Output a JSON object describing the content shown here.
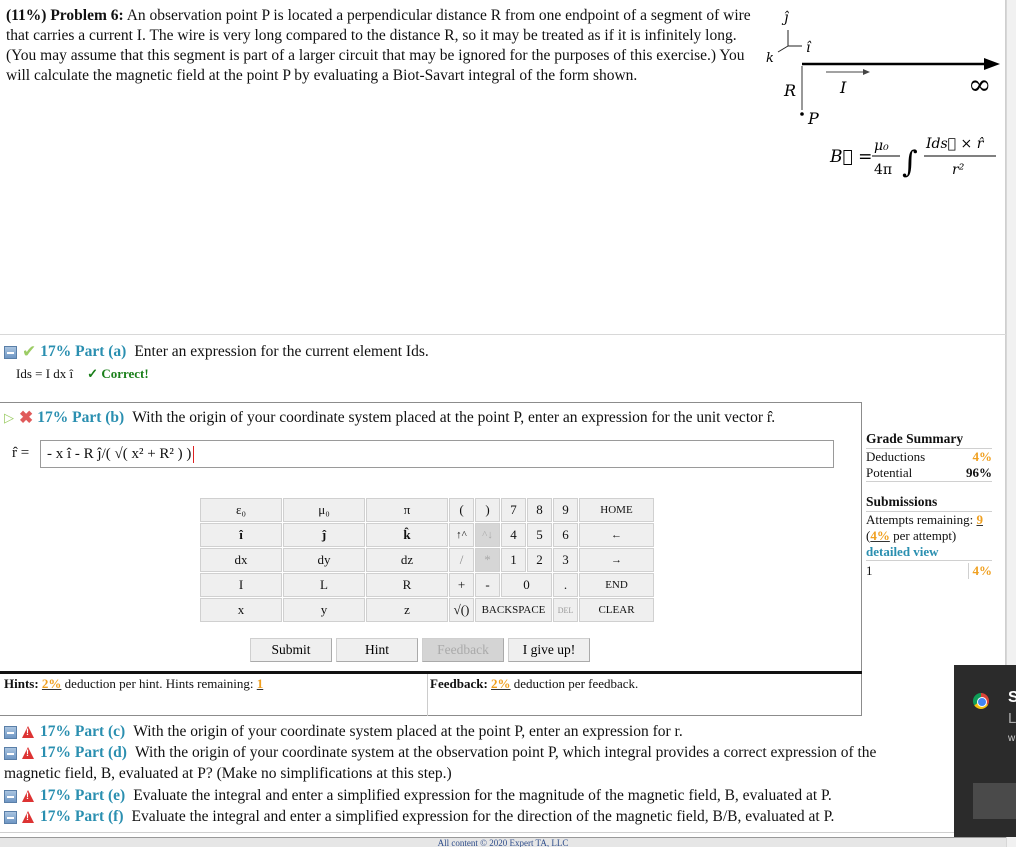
{
  "problem": {
    "weight": "(11%)",
    "title": "Problem 6:",
    "text": "An observation point P is located a perpendicular distance R from one endpoint of a segment of wire that carries a current I. The wire is very long compared to the distance R, so it may be treated as if it is infinitely long. (You may assume that this segment is part of a larger circuit that may be ignored for the purposes of this exercise.) You will calculate the magnetic field at the point P by evaluating a Biot-Savart integral of the form shown."
  },
  "figure": {
    "axis_j": "ĵ",
    "axis_i": "î",
    "axis_k": "k",
    "label_R": "R",
    "label_I": "I",
    "label_P": "P",
    "infinity": "∞",
    "formula_lhs": "B⃗ =",
    "formula_coef_num": "μ₀",
    "formula_coef_den": "4π",
    "formula_integral": "∫",
    "formula_num": "Ids⃗ × r̂",
    "formula_den": "r²"
  },
  "parts": {
    "a": {
      "weight": "17%",
      "label": "Part (a)",
      "text": "Enter an expression for the current element Ids.",
      "answer_lhs": "Ids = I dx î",
      "status": "✓ Correct!"
    },
    "b": {
      "weight": "17%",
      "label": "Part (b)",
      "text": "With the origin of your coordinate system placed at the point P, enter an expression for the unit vector r̂.",
      "input_label": "r̂ =",
      "input_value": "- x î - R ĵ/( √( x² + R² ) )"
    },
    "c": {
      "weight": "17%",
      "label": "Part (c)",
      "text": "With the origin of your coordinate system placed at the point P, enter an expression for r."
    },
    "d": {
      "weight": "17%",
      "label": "Part (d)",
      "text": "With the origin of your coordinate system at the observation point P, which integral provides a correct expression of the",
      "text_cont": "magnetic field, B, evaluated at P? (Make no simplifications at this step.)"
    },
    "e": {
      "weight": "17%",
      "label": "Part (e)",
      "text": "Evaluate the integral and enter a simplified expression for the magnitude of the magnetic field, B, evaluated at P."
    },
    "f": {
      "weight": "17%",
      "label": "Part (f)",
      "text": "Evaluate the integral and enter a simplified expression for the direction of the magnetic field, B/B, evaluated at P."
    }
  },
  "grade_summary": {
    "title": "Grade Summary",
    "deductions_label": "Deductions",
    "deductions_value": "4%",
    "potential_label": "Potential",
    "potential_value": "96%"
  },
  "submissions": {
    "title": "Submissions",
    "attempts_label": "Attempts remaining:",
    "attempts_value": "9",
    "per_attempt_pct": "4%",
    "per_attempt_text": "per attempt)",
    "detailed_view": "detailed view",
    "history_index": "1",
    "history_value": "4%"
  },
  "keypad": {
    "sym": [
      [
        "ε₀",
        "μ₀",
        "π"
      ],
      [
        "î",
        "ĵ",
        "k̂"
      ],
      [
        "dx",
        "dy",
        "dz"
      ],
      [
        "I",
        "L",
        "R"
      ],
      [
        "x",
        "y",
        "z"
      ]
    ],
    "open_paren": "(",
    "close_paren": ")",
    "up_caret": "↑^",
    "caret_down": "^↓",
    "divide": "/",
    "multiply": "*",
    "plus": "+",
    "minus": "-",
    "sqrt": "√()",
    "d7": "7",
    "d8": "8",
    "d9": "9",
    "d4": "4",
    "d5": "5",
    "d6": "6",
    "d1": "1",
    "d2": "2",
    "d3": "3",
    "d0": "0",
    "dot": ".",
    "home": "HOME",
    "left": "←",
    "right": "→",
    "end": "END",
    "backspace": "BACKSPACE",
    "del": "DEL",
    "clear": "CLEAR"
  },
  "buttons": {
    "submit": "Submit",
    "hint": "Hint",
    "feedback": "Feedback",
    "give_up": "I give up!"
  },
  "hints": {
    "label": "Hints:",
    "pct": "2%",
    "text": "deduction per hint. Hints remaining:",
    "remaining": "1"
  },
  "feedback": {
    "label": "Feedback:",
    "pct": "2%",
    "text": "deduction per feedback."
  },
  "footer": {
    "text": "All content © 2020 Expert TA, LLC"
  },
  "notification": {
    "title": "S",
    "line2": "L",
    "line3": "w"
  }
}
